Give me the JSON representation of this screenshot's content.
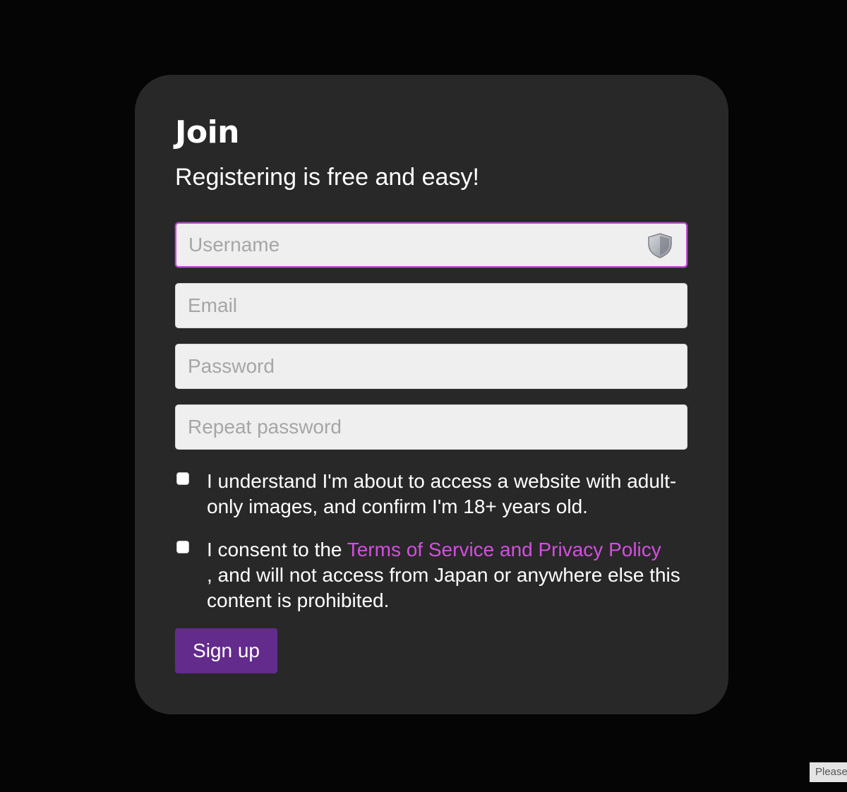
{
  "form": {
    "title": "Join",
    "subtitle": "Registering is free and easy!",
    "fields": {
      "username_placeholder": "Username",
      "email_placeholder": "Email",
      "password_placeholder": "Password",
      "repeat_password_placeholder": "Repeat password"
    },
    "age_consent": {
      "text": "I understand I'm about to access a website with adult-only images, and confirm I'm 18+ years old.",
      "checked": false
    },
    "terms_consent": {
      "prefix": "I consent to the ",
      "link_text": "Terms of Service and Privacy Policy",
      "suffix": ", and will not access from Japan or anywhere else this content is prohibited.",
      "checked": false
    },
    "submit_label": "Sign up"
  },
  "footer_badge": "Please",
  "icons": {
    "username_field_icon": "shield-icon"
  },
  "colors": {
    "background": "#050505",
    "card": "#282828",
    "accent_link": "#d44ee0",
    "button": "#632b8c",
    "focus_border": "#c14ed9"
  }
}
